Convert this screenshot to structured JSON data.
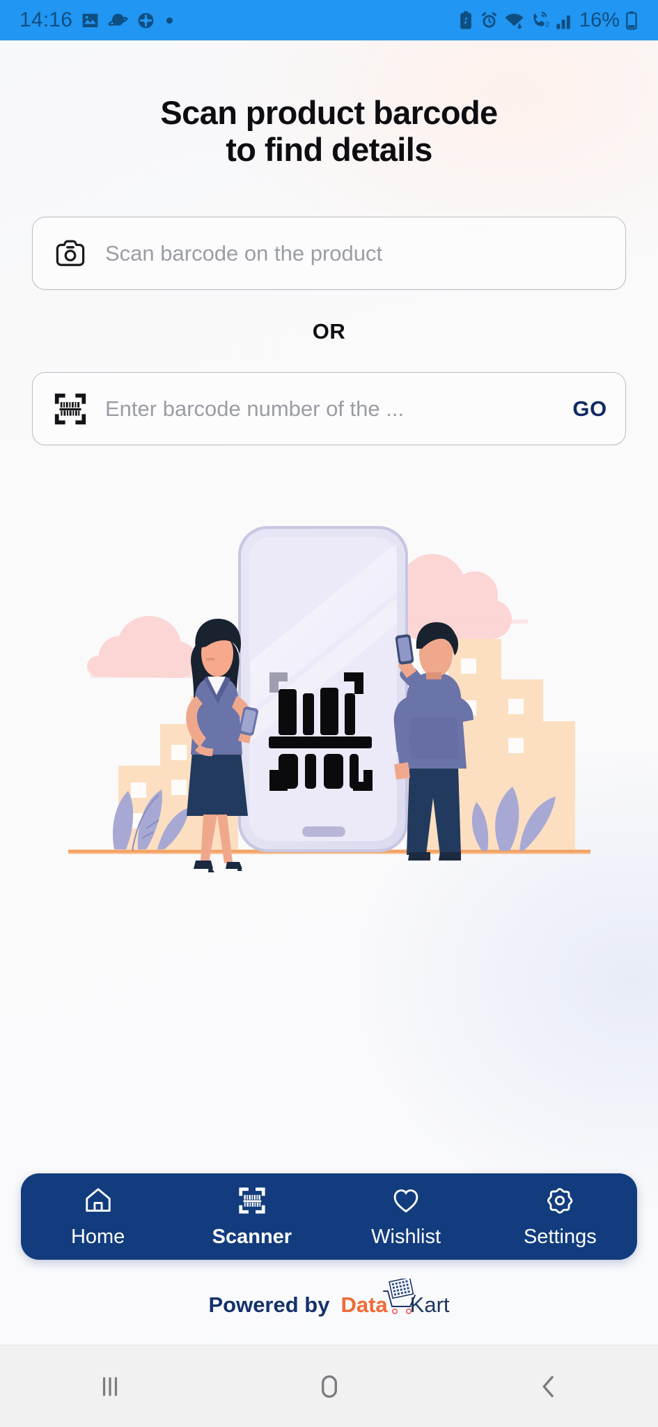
{
  "statusbar": {
    "time": "14:16",
    "battery_pct": "16%",
    "left_icons": [
      "image-icon",
      "planet-icon",
      "color-adjust-icon",
      "dot-indicator"
    ],
    "right_icons": [
      "battery-saver-icon",
      "alarm-icon",
      "wifi-icon",
      "call-sim2-icon",
      "signal-bars-icon",
      "battery-icon"
    ],
    "bg_color": "#2196F3"
  },
  "header": {
    "title_line1": "Scan product barcode",
    "title_line2": "to find details"
  },
  "scan_field": {
    "icon": "camera-icon",
    "placeholder": "Scan barcode on the product",
    "value": ""
  },
  "divider": {
    "label": "OR"
  },
  "barcode_field": {
    "icon": "barcode-scan-icon",
    "placeholder": "Enter barcode number of the ...",
    "value": "",
    "action_label": "GO"
  },
  "illustration": {
    "name": "barcode-scanning-illustration",
    "alt": "Two people scanning a large phone showing a barcode"
  },
  "bottom_nav": {
    "bg_color": "#123C7E",
    "items": [
      {
        "label": "Home",
        "icon": "home-icon",
        "active": false
      },
      {
        "label": "Scanner",
        "icon": "barcode-scan-icon",
        "active": true
      },
      {
        "label": "Wishlist",
        "icon": "heart-icon",
        "active": false
      },
      {
        "label": "Settings",
        "icon": "gear-icon",
        "active": false
      }
    ]
  },
  "footer": {
    "powered_by": "Powered by",
    "brand_first": "Data",
    "brand_second": "Kart",
    "brand_icon": "shopping-cart-icon",
    "brand_first_color": "#ef6b35",
    "brand_second_color": "#1b3664"
  },
  "android_nav": {
    "recents": "recents-icon",
    "home": "home-circle-icon",
    "back": "back-chevron-icon"
  }
}
